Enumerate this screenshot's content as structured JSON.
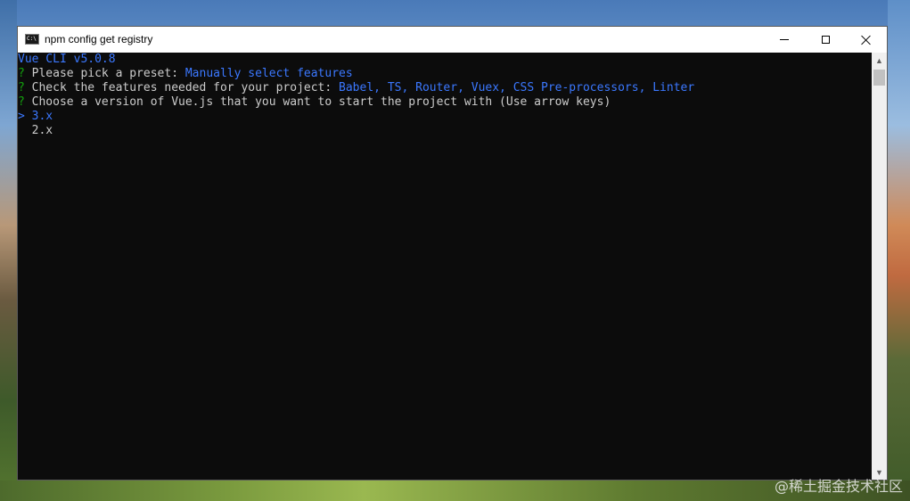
{
  "window": {
    "title": "npm config get registry",
    "icon": "console-icon"
  },
  "console": {
    "header": "Vue CLI v5.0.8",
    "prompts": [
      {
        "marker": "?",
        "question": "Please pick a preset: ",
        "answer": "Manually select features"
      },
      {
        "marker": "?",
        "question": "Check the features needed for your project: ",
        "answer": "Babel, TS, Router, Vuex, CSS Pre-processors, Linter"
      },
      {
        "marker": "?",
        "question": "Choose a version of Vue.js that you want to start the project with (Use arrow keys)",
        "answer": ""
      }
    ],
    "options": [
      {
        "pointer": ">",
        "label": "3.x",
        "selected": true
      },
      {
        "pointer": " ",
        "label": "2.x",
        "selected": false
      }
    ]
  },
  "watermark": "@稀土掘金技术社区",
  "colors": {
    "console_bg": "#0c0c0c",
    "text": "#cccccc",
    "accent_blue": "#3b78ff",
    "prompt_green": "#13a10e"
  }
}
